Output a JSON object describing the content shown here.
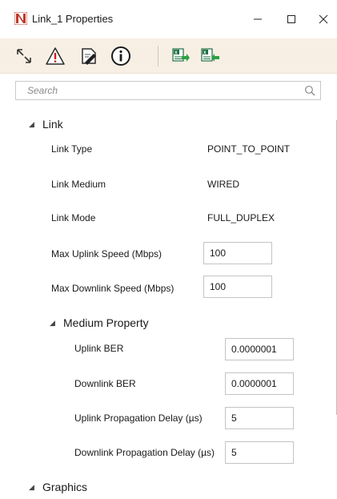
{
  "window": {
    "title": "Link_1 Properties",
    "icon": "netsim-app-icon",
    "controls": [
      "minimize-icon",
      "maximize-icon",
      "close-icon"
    ]
  },
  "toolbar": {
    "tools": [
      {
        "name": "expand-collapse-icon"
      },
      {
        "name": "warning-icon"
      },
      {
        "name": "edit-document-icon"
      },
      {
        "name": "info-icon"
      },
      {
        "name": "excel-export-icon"
      },
      {
        "name": "excel-import-icon"
      }
    ],
    "accent_color": "#f8efe4"
  },
  "search": {
    "placeholder": "Search",
    "value": ""
  },
  "link": {
    "label": "Link",
    "props": [
      {
        "label": "Link Type",
        "value": "POINT_TO_POINT"
      },
      {
        "label": "Link Medium",
        "value": "WIRED"
      },
      {
        "label": "Link Mode",
        "value": "FULL_DUPLEX"
      },
      {
        "label": "Max Uplink Speed (Mbps)",
        "value": "100"
      },
      {
        "label": "Max Downlink Speed (Mbps)",
        "value": "100"
      }
    ]
  },
  "medium": {
    "label": "Medium Property",
    "props": [
      {
        "label": "Uplink BER",
        "value": "0.0000001"
      },
      {
        "label": "Downlink BER",
        "value": "0.0000001"
      },
      {
        "label": "Uplink Propagation Delay (µs)",
        "value": "5"
      },
      {
        "label": "Downlink Propagation Delay (µs)",
        "value": "5"
      }
    ]
  },
  "graphics": {
    "label": "Graphics"
  }
}
